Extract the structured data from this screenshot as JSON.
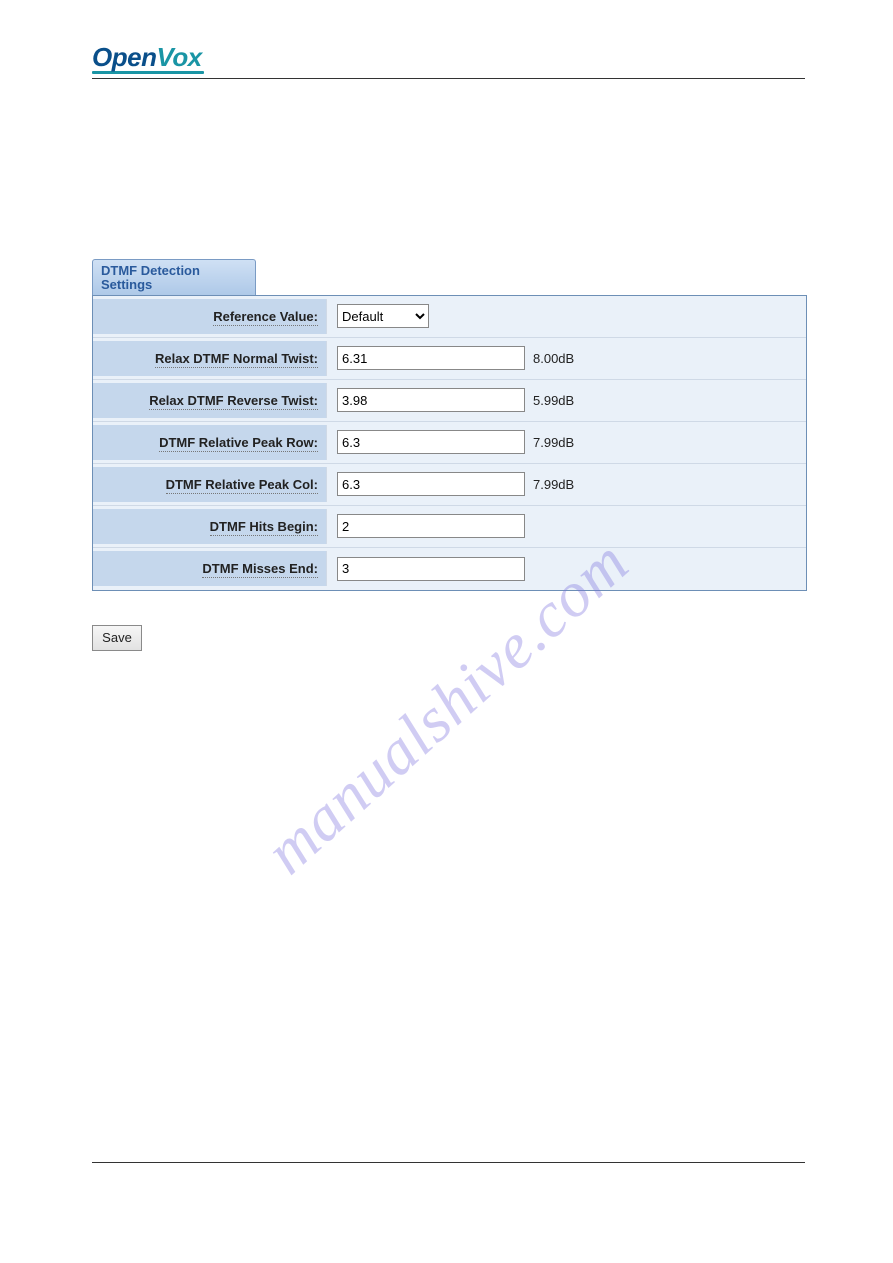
{
  "logo": {
    "part1": "Open",
    "part2": "Vox"
  },
  "tab": {
    "title": "DTMF Detection Settings"
  },
  "form": {
    "rows": [
      {
        "label": "Reference Value:",
        "type": "select",
        "value": "Default",
        "suffix": ""
      },
      {
        "label": "Relax DTMF Normal Twist:",
        "type": "text",
        "value": "6.31",
        "suffix": "8.00dB"
      },
      {
        "label": "Relax DTMF Reverse Twist:",
        "type": "text",
        "value": "3.98",
        "suffix": "5.99dB"
      },
      {
        "label": "DTMF Relative Peak Row:",
        "type": "text",
        "value": "6.3",
        "suffix": "7.99dB"
      },
      {
        "label": "DTMF Relative Peak Col:",
        "type": "text",
        "value": "6.3",
        "suffix": "7.99dB"
      },
      {
        "label": "DTMF Hits Begin:",
        "type": "text",
        "value": "2",
        "suffix": ""
      },
      {
        "label": "DTMF Misses End:",
        "type": "text",
        "value": "3",
        "suffix": ""
      }
    ]
  },
  "save_label": "Save",
  "watermark": "manualshive.com"
}
